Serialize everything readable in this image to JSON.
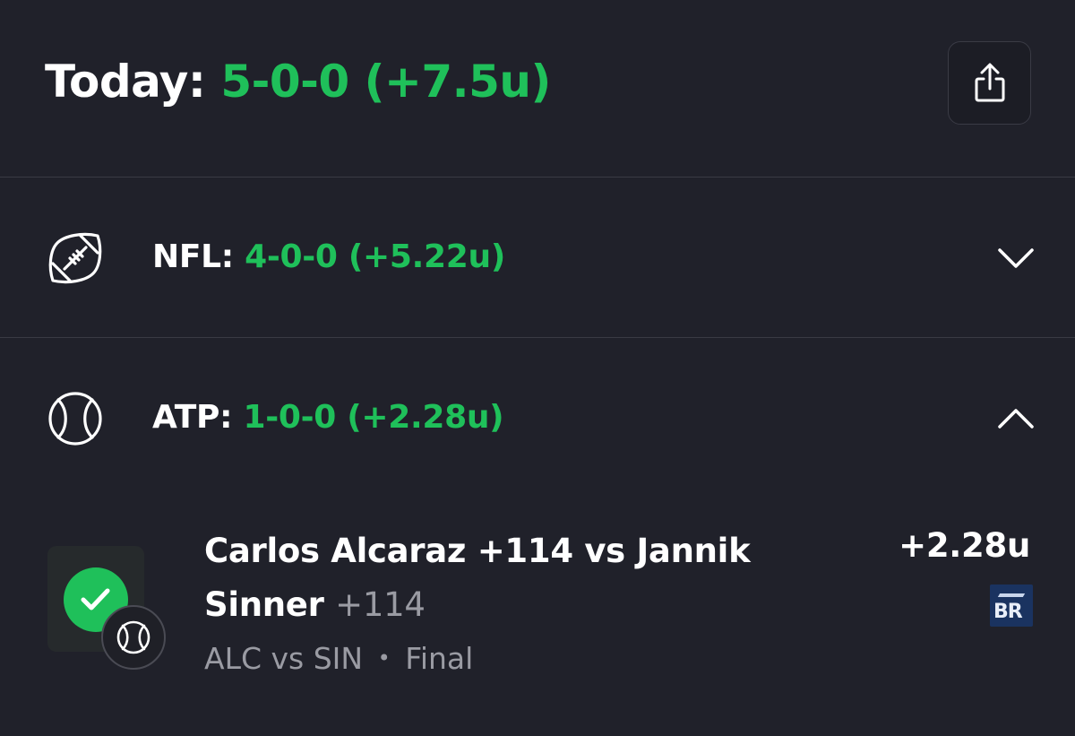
{
  "header": {
    "label": "Today:",
    "record": "5-0-0 (+7.5u)"
  },
  "icons": {
    "share": "share-icon",
    "football": "football-icon",
    "tennis": "tennis-ball-icon",
    "check": "check-icon"
  },
  "colors": {
    "background": "#20212a",
    "accent_green": "#1fc05a",
    "muted": "#9a9ba3"
  },
  "leagues": [
    {
      "label": "NFL:",
      "record": "4-0-0 (+5.22u)",
      "expanded": false
    },
    {
      "label": "ATP:",
      "record": "1-0-0 (+2.28u)",
      "expanded": true
    }
  ],
  "bet": {
    "title": "Carlos Alcaraz +114 vs Jannik Sinner",
    "odds": "+114",
    "matchup": "ALC vs SIN",
    "separator": "•",
    "status": "Final",
    "result": "+2.28u",
    "book_logo": "BR"
  }
}
